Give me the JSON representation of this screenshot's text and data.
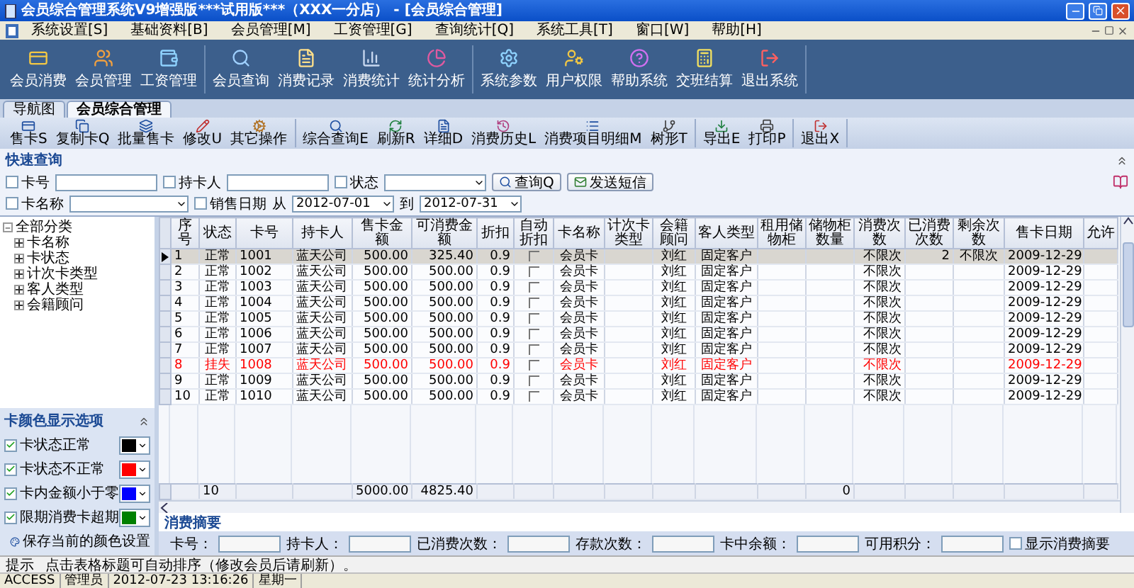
{
  "window": {
    "title": "会员综合管理系统V9增强版***试用版***（XXX一分店） - [会员综合管理]"
  },
  "menu": [
    "系统设置[S]",
    "基础资料[B]",
    "会员管理[M]",
    "工资管理[G]",
    "查询统计[Q]",
    "系统工具[T]",
    "窗口[W]",
    "帮助[H]"
  ],
  "toolbar": [
    [
      "会员消费",
      "会员管理",
      "工资管理"
    ],
    [
      "会员查询",
      "消费记录",
      "消费统计",
      "统计分析"
    ],
    [
      "系统参数",
      "用户权限",
      "帮助系统",
      "交班结算",
      "退出系统"
    ]
  ],
  "tabs": [
    {
      "label": "导航图",
      "selected": false
    },
    {
      "label": "会员综合管理",
      "selected": true
    }
  ],
  "actions": [
    [
      "售卡S",
      "复制卡Q",
      "批量售卡",
      "修改U",
      "其它操作"
    ],
    [
      "综合查询E",
      "刷新R",
      "详细D",
      "消费历史L",
      "消费项目明细M",
      "树形T"
    ],
    [
      "导出E",
      "打印P"
    ],
    [
      "退出X"
    ]
  ],
  "quick_query": {
    "title": "快速查询",
    "row1": [
      {
        "label": "卡号",
        "checked": false,
        "kind": "input"
      },
      {
        "label": "持卡人",
        "checked": false,
        "kind": "input"
      },
      {
        "label": "状态",
        "checked": false,
        "kind": "select"
      }
    ],
    "query_button": "查询Q",
    "sms_button": "发送短信",
    "card_name": {
      "label": "卡名称",
      "checked": false
    },
    "sale_date": {
      "label": "销售日期",
      "checked": false,
      "from_label": "从",
      "from": "2012-07-01",
      "to_label": "到",
      "to": "2012-07-31"
    }
  },
  "tree": {
    "label": "全部分类",
    "expanded": true,
    "children": [
      {
        "label": "卡名称",
        "expanded": false
      },
      {
        "label": "卡状态",
        "expanded": false
      },
      {
        "label": "计次卡类型",
        "expanded": false
      },
      {
        "label": "客人类型",
        "expanded": false
      },
      {
        "label": "会籍顾问",
        "expanded": false
      }
    ]
  },
  "color_options": {
    "title": "卡颜色显示选项",
    "items": [
      {
        "label": "卡状态正常",
        "checked": true,
        "color": "#000000"
      },
      {
        "label": "卡状态不正常",
        "checked": true,
        "color": "#ff0000"
      },
      {
        "label": "卡内金额小于零",
        "checked": true,
        "color": "#0000ff"
      },
      {
        "label": "限期消费卡超期",
        "checked": true,
        "color": "#008000"
      }
    ],
    "save": "保存当前的颜色设置"
  },
  "table": {
    "columns": [
      "序号",
      "状态",
      "卡号",
      "持卡人",
      "售卡金额",
      "可消费金额",
      "折扣",
      "自动折扣",
      "卡名称",
      "计次卡类型",
      "会籍顾问",
      "客人类型",
      "租用储物柜",
      "储物柜数量",
      "消费次数",
      "已消费次数",
      "剩余次数",
      "售卡日期",
      "允许"
    ],
    "rows": [
      {
        "selected": true,
        "color": "#000000",
        "seq": "1",
        "status": "正常",
        "card_no": "1001",
        "holder": "蓝天公司",
        "sale_amount": "500.00",
        "spendable": "325.40",
        "discount": "0.9",
        "auto_discount": false,
        "card_name": "会员卡",
        "counsellor": "刘红",
        "guest_type": "固定客户",
        "times": "不限次",
        "consumed": "2",
        "remaining": "不限次",
        "sale_date": "2009-12-29"
      },
      {
        "selected": false,
        "color": "#000000",
        "seq": "2",
        "status": "正常",
        "card_no": "1002",
        "holder": "蓝天公司",
        "sale_amount": "500.00",
        "spendable": "500.00",
        "discount": "0.9",
        "auto_discount": false,
        "card_name": "会员卡",
        "counsellor": "刘红",
        "guest_type": "固定客户",
        "times": "不限次",
        "sale_date": "2009-12-29"
      },
      {
        "selected": false,
        "color": "#000000",
        "seq": "3",
        "status": "正常",
        "card_no": "1003",
        "holder": "蓝天公司",
        "sale_amount": "500.00",
        "spendable": "500.00",
        "discount": "0.9",
        "auto_discount": false,
        "card_name": "会员卡",
        "counsellor": "刘红",
        "guest_type": "固定客户",
        "times": "不限次",
        "sale_date": "2009-12-29"
      },
      {
        "selected": false,
        "color": "#000000",
        "seq": "4",
        "status": "正常",
        "card_no": "1004",
        "holder": "蓝天公司",
        "sale_amount": "500.00",
        "spendable": "500.00",
        "discount": "0.9",
        "auto_discount": false,
        "card_name": "会员卡",
        "counsellor": "刘红",
        "guest_type": "固定客户",
        "times": "不限次",
        "sale_date": "2009-12-29"
      },
      {
        "selected": false,
        "color": "#000000",
        "seq": "5",
        "status": "正常",
        "card_no": "1005",
        "holder": "蓝天公司",
        "sale_amount": "500.00",
        "spendable": "500.00",
        "discount": "0.9",
        "auto_discount": false,
        "card_name": "会员卡",
        "counsellor": "刘红",
        "guest_type": "固定客户",
        "times": "不限次",
        "sale_date": "2009-12-29"
      },
      {
        "selected": false,
        "color": "#000000",
        "seq": "6",
        "status": "正常",
        "card_no": "1006",
        "holder": "蓝天公司",
        "sale_amount": "500.00",
        "spendable": "500.00",
        "discount": "0.9",
        "auto_discount": false,
        "card_name": "会员卡",
        "counsellor": "刘红",
        "guest_type": "固定客户",
        "times": "不限次",
        "sale_date": "2009-12-29"
      },
      {
        "selected": false,
        "color": "#000000",
        "seq": "7",
        "status": "正常",
        "card_no": "1007",
        "holder": "蓝天公司",
        "sale_amount": "500.00",
        "spendable": "500.00",
        "discount": "0.9",
        "auto_discount": false,
        "card_name": "会员卡",
        "counsellor": "刘红",
        "guest_type": "固定客户",
        "times": "不限次",
        "sale_date": "2009-12-29"
      },
      {
        "selected": false,
        "color": "#ff0000",
        "seq": "8",
        "status": "挂失",
        "card_no": "1008",
        "holder": "蓝天公司",
        "sale_amount": "500.00",
        "spendable": "500.00",
        "discount": "0.9",
        "auto_discount": false,
        "card_name": "会员卡",
        "counsellor": "刘红",
        "guest_type": "固定客户",
        "times": "不限次",
        "sale_date": "2009-12-29"
      },
      {
        "selected": false,
        "color": "#000000",
        "seq": "9",
        "status": "正常",
        "card_no": "1009",
        "holder": "蓝天公司",
        "sale_amount": "500.00",
        "spendable": "500.00",
        "discount": "0.9",
        "auto_discount": false,
        "card_name": "会员卡",
        "counsellor": "刘红",
        "guest_type": "固定客户",
        "times": "不限次",
        "sale_date": "2009-12-29"
      },
      {
        "selected": false,
        "color": "#000000",
        "seq": "10",
        "status": "正常",
        "card_no": "1010",
        "holder": "蓝天公司",
        "sale_amount": "500.00",
        "spendable": "500.00",
        "discount": "0.9",
        "auto_discount": false,
        "card_name": "会员卡",
        "counsellor": "刘红",
        "guest_type": "固定客户",
        "times": "不限次",
        "sale_date": "2009-12-29"
      }
    ],
    "totals": {
      "status": "10",
      "sale_amount": "5000.00",
      "spendable": "4825.40",
      "lockers": "0"
    }
  },
  "summary": {
    "title": "消费摘要",
    "fields": [
      "卡号：",
      "持卡人：",
      "已消费次数：",
      "存款次数：",
      "卡中余额：",
      "可用积分："
    ],
    "show_summary": {
      "label": "显示消费摘要",
      "checked": false
    }
  },
  "hint": {
    "label": "提示",
    "text": "点击表格标题可自动排序（修改会员后请刷新）。"
  },
  "status_bar": [
    "ACCESS",
    "管理员",
    "2012-07-23 13:16:26",
    "星期一"
  ]
}
